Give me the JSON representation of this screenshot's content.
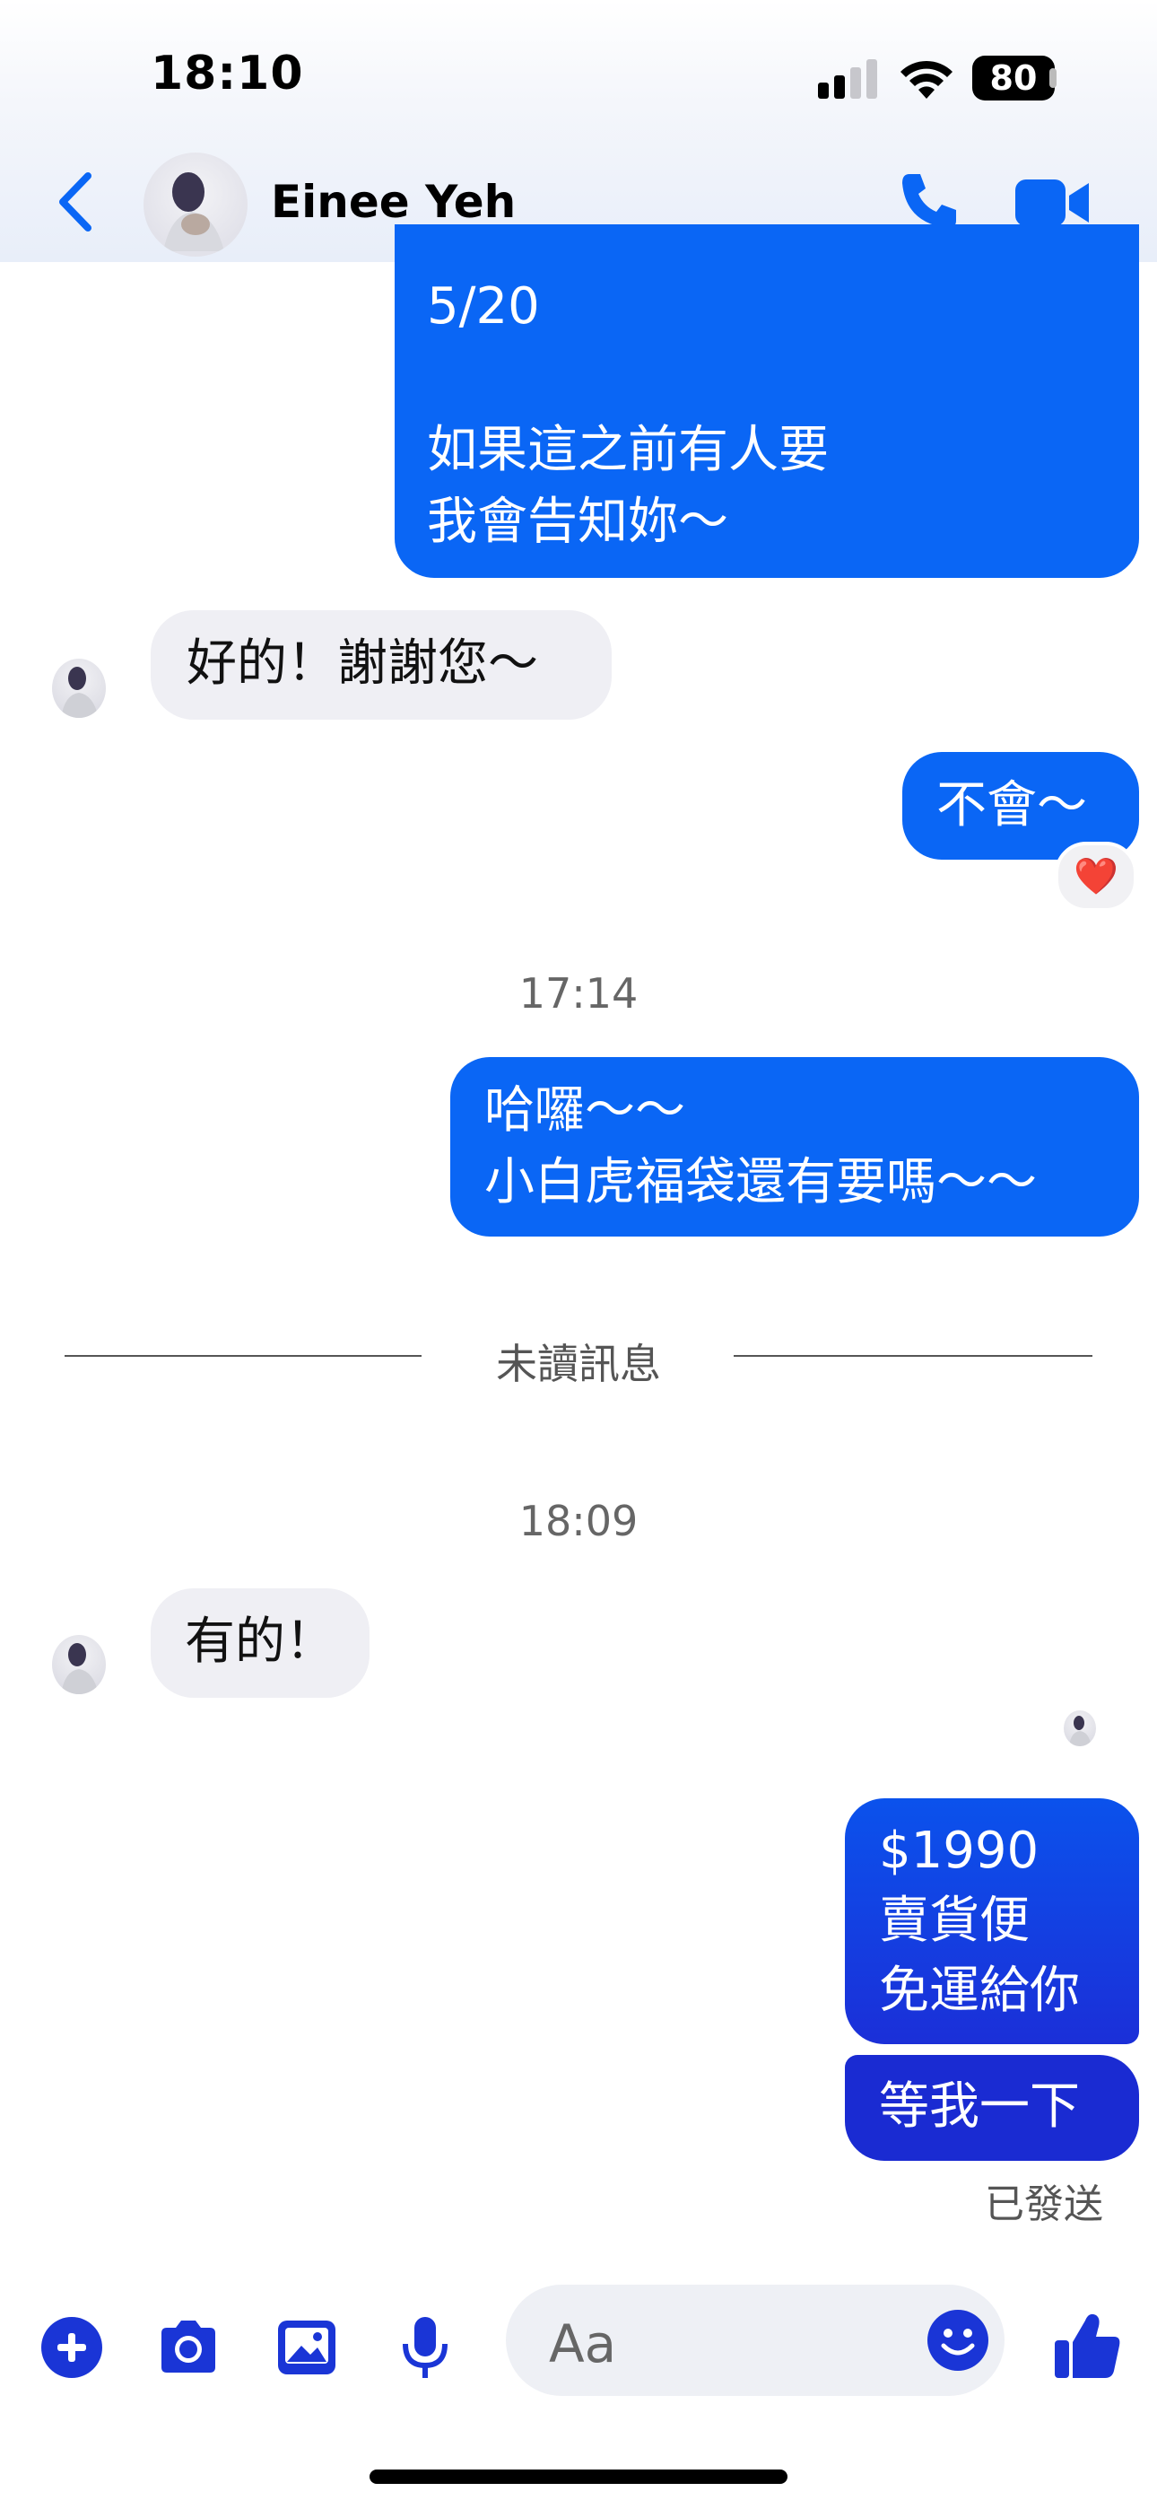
{
  "status_bar": {
    "time": "18:10",
    "battery": "80"
  },
  "header": {
    "contact_name": "Einee Yeh"
  },
  "messages": {
    "m1_top": "5/20\n\n如果這之前有人要\n我會告知妳～",
    "m2_in": "好的！謝謝您～",
    "m3_out": "不會～",
    "m3_reaction": "❤️",
    "stamp1": "17:14",
    "m4_out": "哈囉～～\n小白虎福袋還有要嗎～～",
    "unread_divider": "未讀訊息",
    "stamp2": "18:09",
    "m5_in": "有的！",
    "m6_out": "$1990\n賣貨便\n免運給你",
    "m7_out": "等我一下",
    "status": "已發送"
  },
  "composer": {
    "placeholder": "Aa"
  },
  "colors": {
    "accent": "#0a66f5",
    "incoming_bubble": "#efeff4",
    "icon_blue": "#1a35d6"
  }
}
